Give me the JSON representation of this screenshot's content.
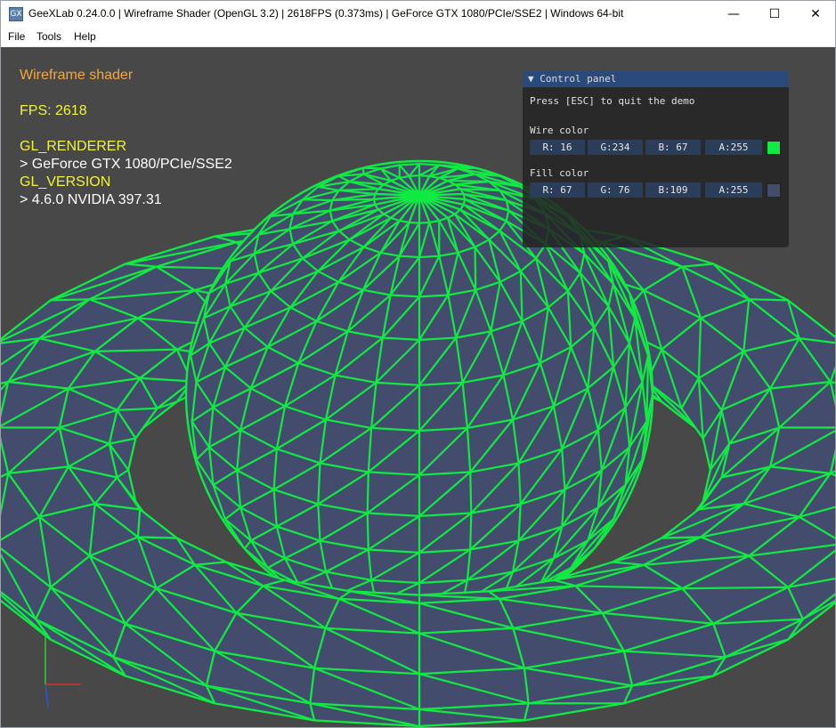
{
  "window": {
    "title": "GeeXLab 0.24.0.0 | Wireframe Shader (OpenGL 3.2) | 2618FPS (0.373ms) | GeForce GTX 1080/PCIe/SSE2 | Windows 64-bit",
    "icon_text": "GX",
    "minimize_glyph": "—",
    "maximize_glyph": "☐",
    "close_glyph": "✕"
  },
  "menu": {
    "items": [
      "File",
      "Tools",
      "Help"
    ]
  },
  "hud": {
    "title": "Wireframe shader",
    "fps": "FPS: 2618",
    "renderer_label": "GL_RENDERER",
    "renderer_value": "> GeForce GTX 1080/PCIe/SSE2",
    "version_label": "GL_VERSION",
    "version_value": "> 4.6.0 NVIDIA 397.31",
    "title_color": "#f5a742",
    "text_color": "#f2f23a",
    "value_color": "#ffffff"
  },
  "panel": {
    "title": "▼ Control panel",
    "instruction": "Press [ESC] to quit the demo",
    "wire": {
      "label": "Wire color",
      "r": "R: 16",
      "g": "G:234",
      "b": "B: 67",
      "a": "A:255",
      "color": "#10ea43"
    },
    "fill": {
      "label": "Fill color",
      "r": "R: 67",
      "g": "G: 76",
      "b": "B:109",
      "a": "A:255",
      "color": "#434c6d"
    }
  },
  "scene": {
    "background": "#484848",
    "wire_color": "#10ea43",
    "fill_color": "#434c6d"
  }
}
